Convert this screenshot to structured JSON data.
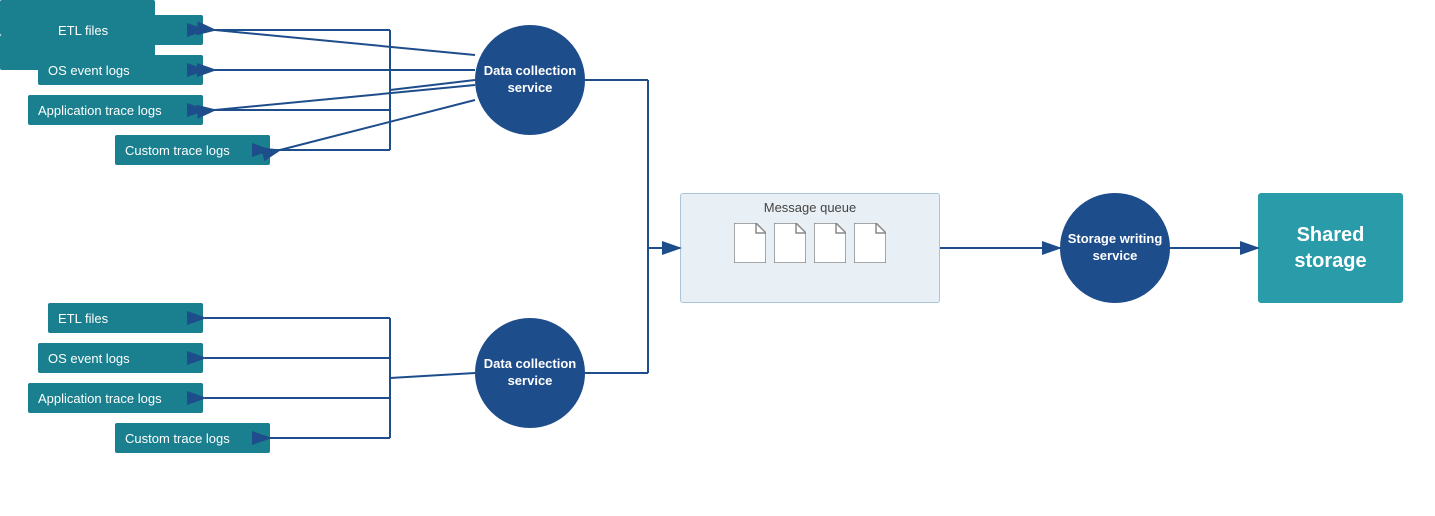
{
  "top_group": {
    "etl": "ETL files",
    "os": "OS event logs",
    "apptrace": "Application trace logs",
    "custom": "Custom trace logs"
  },
  "bottom_group": {
    "etl": "ETL files",
    "os": "OS event logs",
    "apptrace": "Application trace logs",
    "custom": "Custom trace logs"
  },
  "dc_top": "Data collection service",
  "dc_bottom": "Data collection service",
  "mq_label": "Message queue",
  "sw_label": "Storage writing service",
  "shared_storage": "Shared storage",
  "colors": {
    "teal": "#1a7f8e",
    "dark_blue": "#1e4d8c",
    "arrow": "#1e4d8c"
  }
}
